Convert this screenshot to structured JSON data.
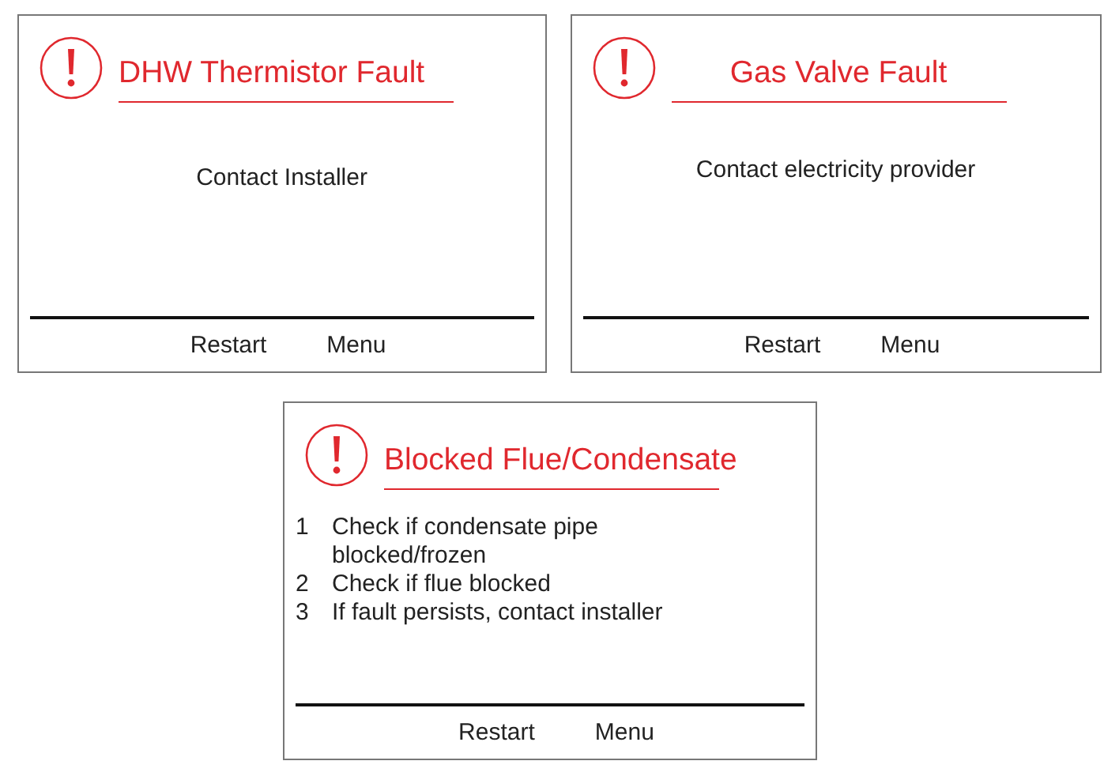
{
  "screens": [
    {
      "kind": "message",
      "title": "DHW Thermistor Fault",
      "message": "Contact Installer",
      "buttons": [
        "Restart",
        "Menu"
      ]
    },
    {
      "kind": "message",
      "title": "Gas Valve Fault",
      "message": "Contact electricity provider",
      "buttons": [
        "Restart",
        "Menu"
      ]
    },
    {
      "kind": "steps",
      "title": "Blocked Flue/Condensate",
      "steps": [
        {
          "number": "1",
          "text": "Check if condensate pipe blocked/frozen"
        },
        {
          "number": "2",
          "text": "Check if flue blocked"
        },
        {
          "number": "3",
          "text": "If fault persists, contact installer"
        }
      ],
      "buttons": [
        "Restart",
        "Menu"
      ]
    }
  ]
}
